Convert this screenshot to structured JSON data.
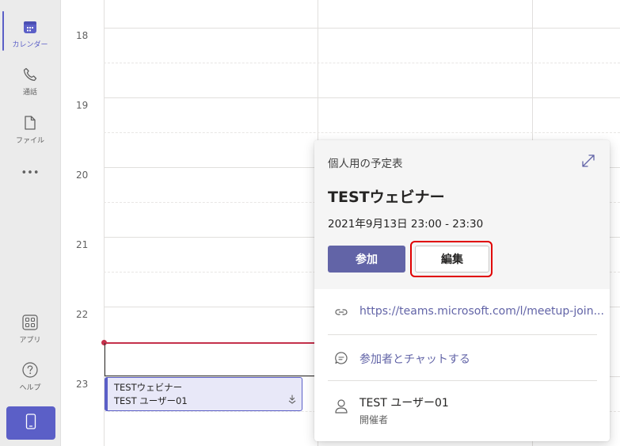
{
  "rail": {
    "items": [
      {
        "label": "カレンダー",
        "icon": "calendar-icon"
      },
      {
        "label": "通話",
        "icon": "phone-icon"
      },
      {
        "label": "ファイル",
        "icon": "file-icon"
      },
      {
        "label": "•••",
        "icon": "more-icon"
      },
      {
        "label": "アプリ",
        "icon": "apps-icon"
      },
      {
        "label": "ヘルプ",
        "icon": "help-icon"
      }
    ],
    "mobile_icon": "mobile-icon"
  },
  "calendar": {
    "hours": [
      "18",
      "19",
      "20",
      "21",
      "22",
      "23"
    ],
    "event": {
      "title": "TESTウェビナー",
      "organizer": "TEST ユーザー01"
    }
  },
  "card": {
    "calendar_name": "個人用の予定表",
    "title": "TESTウェビナー",
    "datetime": "2021年9月13日 23:00 - 23:30",
    "join_label": "参加",
    "edit_label": "編集",
    "link": "https://teams.microsoft.com/l/meetup-join...",
    "chat_label": "参加者とチャットする",
    "organizer_name": "TEST ユーザー01",
    "organizer_role": "開催者"
  },
  "colors": {
    "accent": "#6264a7",
    "now_line": "#c4314b",
    "highlight": "#e00000"
  }
}
